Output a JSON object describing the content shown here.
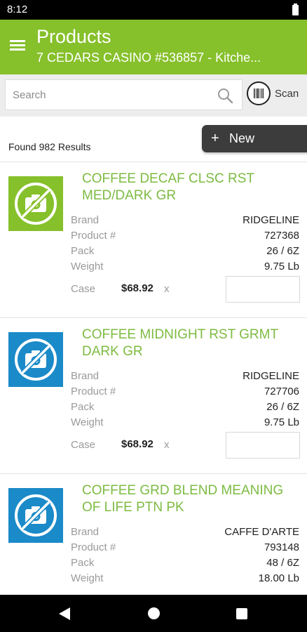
{
  "status_bar": {
    "time": "8:12"
  },
  "app_bar": {
    "title": "Products",
    "subtitle": "7 CEDARS CASINO #536857 - Kitche..."
  },
  "search": {
    "placeholder": "Search",
    "value": "",
    "scan_label": "Scan"
  },
  "results": {
    "count_text": "Found 982 Results"
  },
  "new_button": {
    "label": "New",
    "icon": "plus-icon"
  },
  "labels": {
    "brand": "Brand",
    "product_no": "Product #",
    "pack": "Pack",
    "weight": "Weight",
    "case": "Case",
    "times": "x"
  },
  "products": [
    {
      "name": "COFFEE DECAF CLSC RST MED/DARK GR",
      "brand": "RIDGELINE",
      "product_no": "727368",
      "pack": "26 / 6Z",
      "weight": "9.75 Lb",
      "case_price": "$68.92",
      "thumb_color": "#86c02b",
      "icon": "no-image-icon"
    },
    {
      "name": "COFFEE MIDNIGHT RST GRMT DARK GR",
      "brand": "RIDGELINE",
      "product_no": "727706",
      "pack": "26 / 6Z",
      "weight": "9.75 Lb",
      "case_price": "$68.92",
      "thumb_color": "#1b8ac8",
      "icon": "no-image-icon"
    },
    {
      "name": "COFFEE GRD BLEND MEANING OF LIFE PTN PK",
      "brand": "CAFFE D'ARTE",
      "product_no": "793148",
      "pack": "48 / 6Z",
      "weight": "18.00 Lb",
      "case_price": "",
      "thumb_color": "#1b8ac8",
      "icon": "no-image-icon"
    }
  ],
  "colors": {
    "accent": "#86c02b",
    "product_title": "#7dbb42",
    "thumb_blue": "#1b8ac8",
    "dark_button": "#3c3c3c"
  }
}
